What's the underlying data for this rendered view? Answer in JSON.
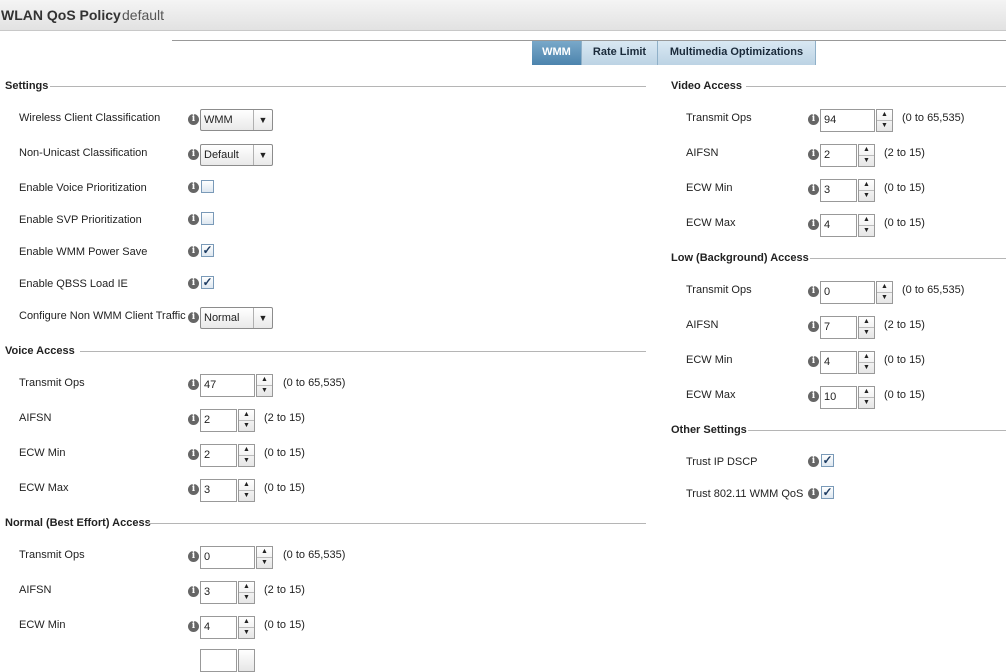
{
  "header": {
    "title": "WLAN QoS Policy",
    "subtitle": "default"
  },
  "tabs": [
    "WMM",
    "Rate Limit",
    "Multimedia Optimizations"
  ],
  "settings": {
    "heading": "Settings",
    "wireless_client_classification": {
      "label": "Wireless Client Classification",
      "value": "WMM"
    },
    "non_unicast_classification": {
      "label": "Non-Unicast Classification",
      "value": "Default"
    },
    "enable_voice_prioritization": {
      "label": "Enable Voice Prioritization",
      "checked": false
    },
    "enable_svp_prioritization": {
      "label": "Enable SVP Prioritization",
      "checked": false
    },
    "enable_wmm_power_save": {
      "label": "Enable WMM Power Save",
      "checked": true
    },
    "enable_qbss_load_ie": {
      "label": "Enable QBSS Load IE",
      "checked": true
    },
    "configure_non_wmm_client_traffic": {
      "label": "Configure Non WMM Client Traffic",
      "value": "Normal"
    }
  },
  "voice_access": {
    "heading": "Voice Access",
    "transmit_ops": {
      "label": "Transmit Ops",
      "value": "47",
      "range": "(0 to 65,535)"
    },
    "aifsn": {
      "label": "AIFSN",
      "value": "2",
      "range": "(2 to 15)"
    },
    "ecw_min": {
      "label": "ECW Min",
      "value": "2",
      "range": "(0 to 15)"
    },
    "ecw_max": {
      "label": "ECW Max",
      "value": "3",
      "range": "(0 to 15)"
    }
  },
  "normal_access": {
    "heading": "Normal (Best Effort) Access",
    "transmit_ops": {
      "label": "Transmit Ops",
      "value": "0",
      "range": "(0 to 65,535)"
    },
    "aifsn": {
      "label": "AIFSN",
      "value": "3",
      "range": "(2 to 15)"
    },
    "ecw_min": {
      "label": "ECW Min",
      "value": "4",
      "range": "(0 to 15)"
    }
  },
  "video_access": {
    "heading": "Video Access",
    "transmit_ops": {
      "label": "Transmit Ops",
      "value": "94",
      "range": "(0 to 65,535)"
    },
    "aifsn": {
      "label": "AIFSN",
      "value": "2",
      "range": "(2 to 15)"
    },
    "ecw_min": {
      "label": "ECW Min",
      "value": "3",
      "range": "(0 to 15)"
    },
    "ecw_max": {
      "label": "ECW Max",
      "value": "4",
      "range": "(0 to 15)"
    }
  },
  "low_access": {
    "heading": "Low (Background) Access",
    "transmit_ops": {
      "label": "Transmit Ops",
      "value": "0",
      "range": "(0 to 65,535)"
    },
    "aifsn": {
      "label": "AIFSN",
      "value": "7",
      "range": "(2 to 15)"
    },
    "ecw_min": {
      "label": "ECW Min",
      "value": "4",
      "range": "(0 to 15)"
    },
    "ecw_max": {
      "label": "ECW Max",
      "value": "10",
      "range": "(0 to 15)"
    }
  },
  "other_settings": {
    "heading": "Other Settings",
    "trust_ip_dscp": {
      "label": "Trust IP DSCP",
      "checked": true
    },
    "trust_wmm_qos": {
      "label": "Trust 802.11 WMM QoS",
      "checked": true
    }
  },
  "icons": {
    "info": "info-icon",
    "dropdown": "chevron-down-icon",
    "spin_up": "arrow-up-icon",
    "spin_down": "arrow-down-icon"
  }
}
